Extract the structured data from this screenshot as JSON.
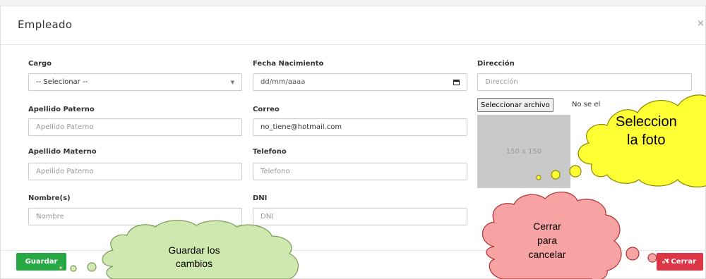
{
  "modal": {
    "title": "Empleado",
    "close_icon": "×"
  },
  "form": {
    "cargo": {
      "label": "Cargo",
      "selected": "-- Selecionar --"
    },
    "fecha_nacimiento": {
      "label": "Fecha Nacimiento",
      "value": "dd/mm/aaaa"
    },
    "direccion": {
      "label": "Dirección",
      "placeholder": "Dirección"
    },
    "apellido_paterno": {
      "label": "Apellido Paterno",
      "placeholder": "Apellido Paterno"
    },
    "correo": {
      "label": "Correo",
      "value": "no_tiene@hotmail.com"
    },
    "apellido_materno": {
      "label": "Apellido Materno",
      "placeholder": "Apellido Paterno"
    },
    "telefono": {
      "label": "Telefono",
      "placeholder": "Telefono"
    },
    "nombres": {
      "label": "Nombre(s)",
      "placeholder": "Nombre"
    },
    "dni": {
      "label": "DNI",
      "placeholder": "DNI"
    },
    "file": {
      "button": "Seleccionar archivo",
      "status": "No se el"
    },
    "photo_placeholder": "150 x 150"
  },
  "footer": {
    "save_label": "Guardar",
    "close_label": "Cerrar"
  },
  "callouts": {
    "photo": [
      "Seleccion",
      "la  foto"
    ],
    "save": [
      "Guardar los",
      "cambios"
    ],
    "cancel": [
      "Cerrar",
      "para",
      "cancelar"
    ]
  },
  "colors": {
    "save": "#28a745",
    "close": "#dc3545",
    "photo_callout": "#ffff33",
    "save_callout": "#cfe8b0",
    "cancel_callout": "#f8a3a3"
  }
}
